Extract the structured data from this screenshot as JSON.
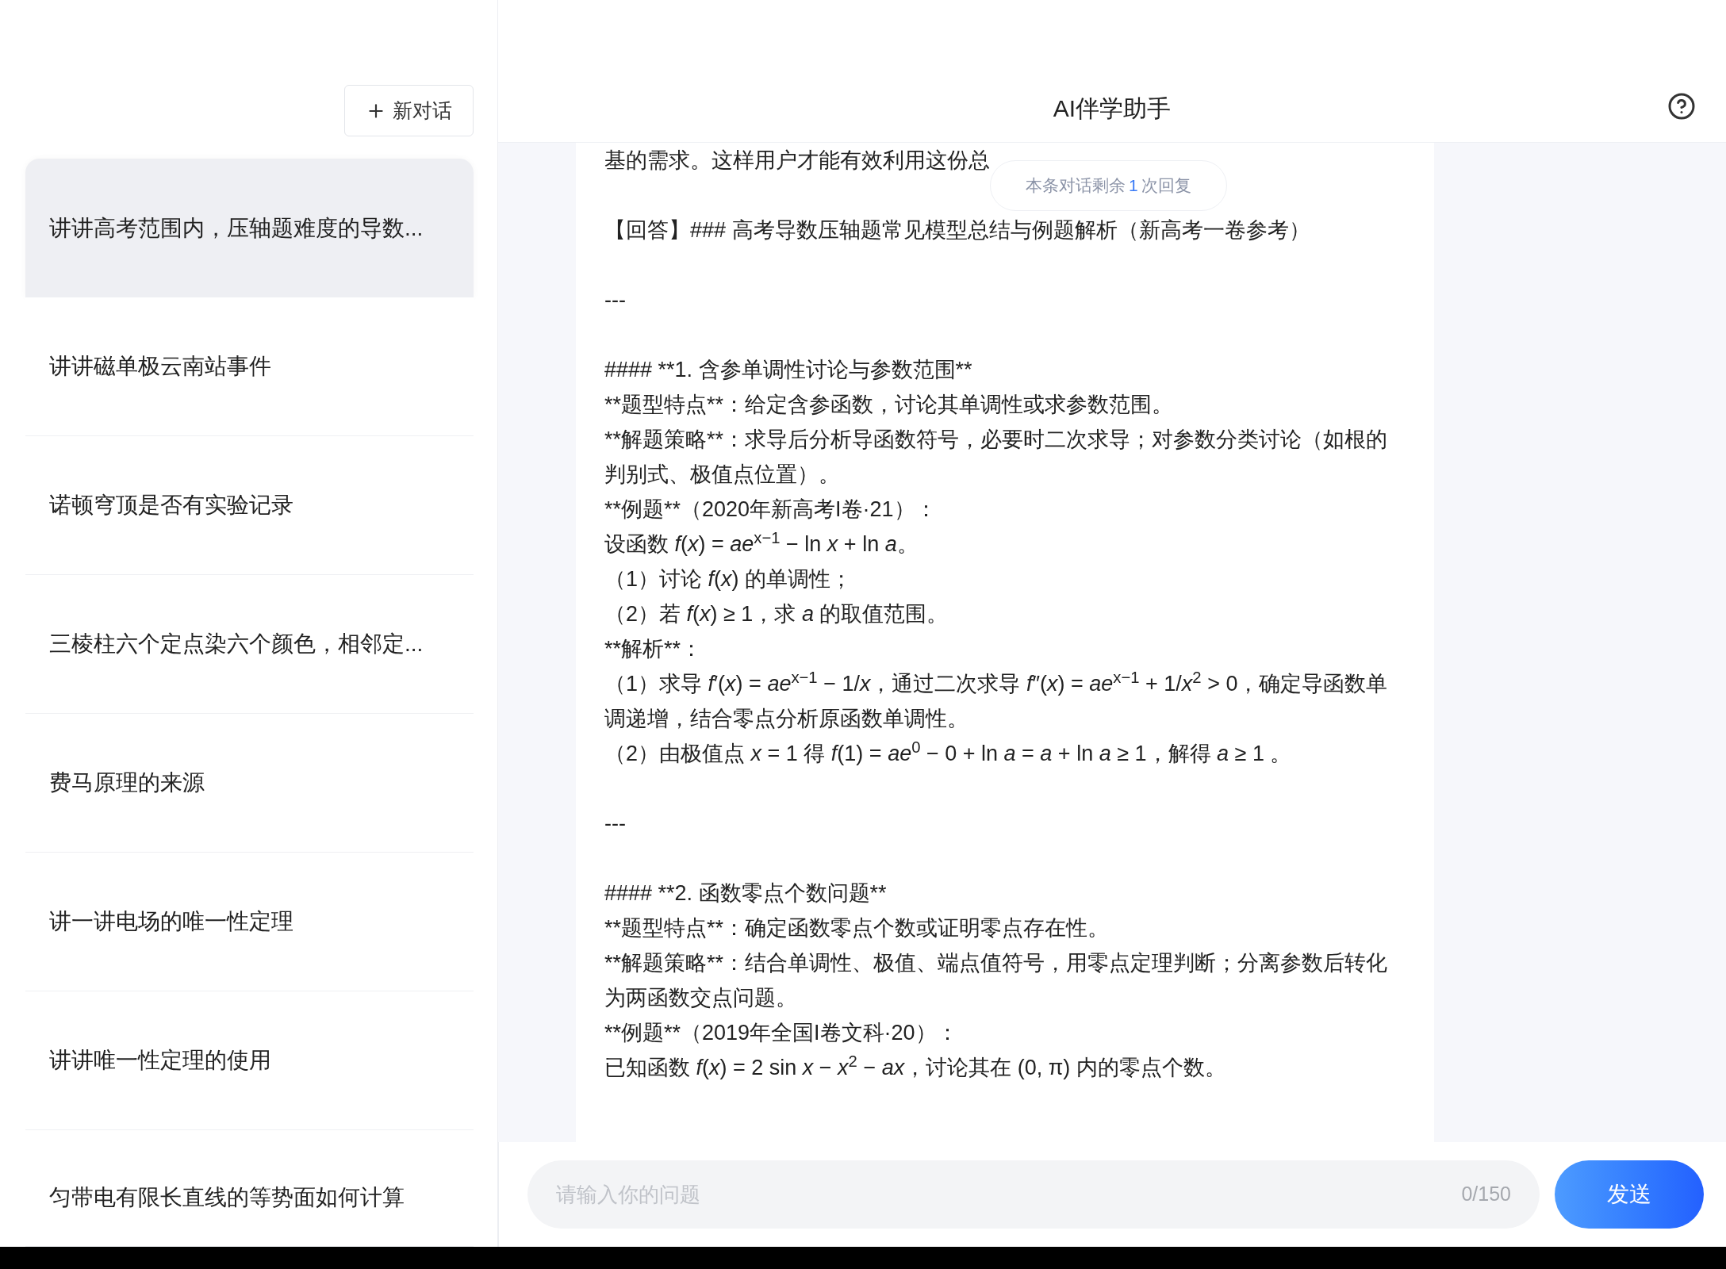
{
  "sidebar": {
    "new_chat_button": {
      "label": "新对话"
    },
    "conversations": [
      {
        "title": "讲讲高考范围内，压轴题难度的导数...",
        "selected": true
      },
      {
        "title": "讲讲磁单极云南站事件",
        "selected": false
      },
      {
        "title": "诺顿穹顶是否有实验记录",
        "selected": false
      },
      {
        "title": "三棱柱六个定点染六个颜色，相邻定...",
        "selected": false
      },
      {
        "title": "费马原理的来源",
        "selected": false
      },
      {
        "title": "讲一讲电场的唯一性定理",
        "selected": false
      },
      {
        "title": "讲讲唯一性定理的使用",
        "selected": false
      },
      {
        "title": "匀带电有限长直线的等势面如何计算",
        "selected": false
      }
    ]
  },
  "header": {
    "title": "AI伴学助手"
  },
  "reply_badge": {
    "prefix": "本条对话剩余",
    "count": "1",
    "suffix": "次回复"
  },
  "content": {
    "lines": [
      {
        "kind": "plain",
        "text": "基的需求。这样用户才能有效利用这份总"
      },
      {
        "kind": "spacer"
      },
      {
        "kind": "plain",
        "text": "【回答】### 高考导数压轴题常见模型总结与例题解析（新高考一卷参考）"
      },
      {
        "kind": "spacer"
      },
      {
        "kind": "plain",
        "text": "---"
      },
      {
        "kind": "spacer"
      },
      {
        "kind": "plain",
        "text": "#### **1. 含参单调性讨论与参数范围**"
      },
      {
        "kind": "plain",
        "text": "**题型特点**：给定含参函数，讨论其单调性或求参数范围。"
      },
      {
        "kind": "plain",
        "text": "**解题策略**：求导后分析导函数符号，必要时二次求导；对参数分类讨论（如根的判别式、极值点位置）。"
      },
      {
        "kind": "plain",
        "text": "**例题**（2020年新高考I卷·21）："
      },
      {
        "kind": "math",
        "text": "设函数 *f*(*x*) = *ae*$^{x−1}$ − ln *x* + ln *a*。"
      },
      {
        "kind": "math",
        "text": "（1）讨论 *f*(*x*) 的单调性；"
      },
      {
        "kind": "math",
        "text": "（2）若 *f*(*x*) ≥ 1，求 *a* 的取值范围。"
      },
      {
        "kind": "plain",
        "text": "**解析**："
      },
      {
        "kind": "math",
        "text": "（1）求导 *f*′(*x*) = *ae*$^{x−1}$ − 1/*x*，通过二次求导 *f*″(*x*) = *ae*$^{x−1}$ + 1/*x*$^{2}$ > 0，确定导函数单调递增，结合零点分析原函数单调性。"
      },
      {
        "kind": "math",
        "text": "（2）由极值点 *x* = 1 得 *f*(1) = *ae*$^{0}$ − 0 + ln *a* = *a* + ln *a* ≥ 1，解得 *a* ≥ 1 。"
      },
      {
        "kind": "spacer"
      },
      {
        "kind": "plain",
        "text": "---"
      },
      {
        "kind": "spacer"
      },
      {
        "kind": "plain",
        "text": "#### **2. 函数零点个数问题**"
      },
      {
        "kind": "plain",
        "text": "**题型特点**：确定函数零点个数或证明零点存在性。"
      },
      {
        "kind": "plain",
        "text": "**解题策略**：结合单调性、极值、端点值符号，用零点定理判断；分离参数后转化为两函数交点问题。"
      },
      {
        "kind": "plain",
        "text": "**例题**（2019年全国I卷文科·20）："
      },
      {
        "kind": "math",
        "text": "已知函数 *f*(*x*) = 2 sin *x* − *x*$^{2}$ − *ax*，讨论其在 (0, π) 内的零点个数。"
      }
    ]
  },
  "input": {
    "placeholder": "请输入你的问题",
    "counter": "0/150",
    "send_button": "发送"
  }
}
